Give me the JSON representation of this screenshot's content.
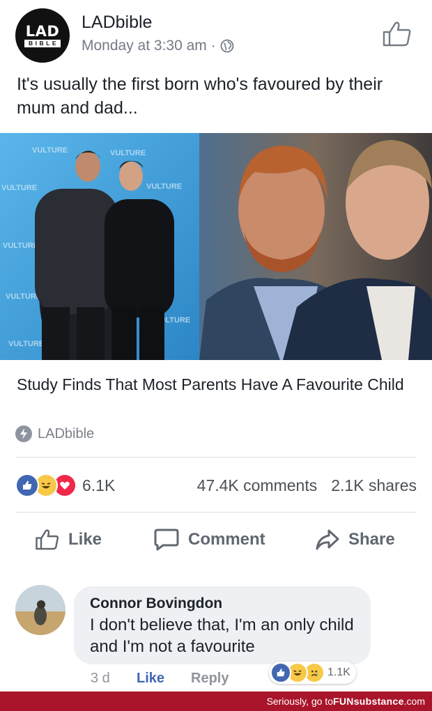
{
  "post": {
    "page_name": "LADbible",
    "avatar_line1": "LAD",
    "avatar_line2": "BIBLE",
    "time": "Monday at 3:30 am",
    "dot": "·",
    "text": "It's usually the first born who's favoured by their mum and dad...",
    "image_left_backdrop_text": "VULTURE",
    "link_title": "Study Finds That Most Parents Have A Favourite Child",
    "link_source": "LADbible"
  },
  "counts": {
    "reactions": "6.1K",
    "comments": "47.4K comments",
    "shares": "2.1K shares"
  },
  "actions": {
    "like": "Like",
    "comment": "Comment",
    "share": "Share"
  },
  "comment": {
    "author": "Connor Bovingdon",
    "text": "I don't believe that, I'm an only child and I'm not a favourite",
    "time": "3 d",
    "like": "Like",
    "reply": "Reply",
    "reaction_count": "1.1K"
  },
  "watermark": {
    "prefix": "Seriously, go to ",
    "brand": "FUNsubstance",
    "suffix": ".com"
  },
  "colors": {
    "like_blue": "#4267b2",
    "haha_yellow": "#f7c948",
    "love_red": "#f0284a",
    "watermark_red": "#a8152a",
    "action_gray": "#606770"
  },
  "icons": {
    "reactions": [
      "like-reaction-icon",
      "haha-reaction-icon",
      "love-reaction-icon"
    ],
    "comment_reactions": [
      "like-reaction-icon",
      "haha-reaction-icon",
      "sad-reaction-icon"
    ]
  }
}
